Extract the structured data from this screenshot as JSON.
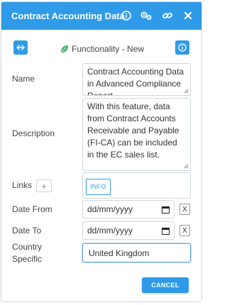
{
  "dialog": {
    "title": "Contract Accounting Data",
    "icons": [
      "info-icon",
      "settings-icon",
      "link-icon",
      "close-icon"
    ],
    "accent_color": "#2f9be8"
  },
  "toolbar": {
    "expand_icon": "expand-arrows-icon",
    "leaf_icon": "leaf-icon",
    "center_label": "Functionality - New",
    "info_icon": "info-icon"
  },
  "form": {
    "name_label": "Name",
    "name_value": "Contract Accounting Data in Advanced Compliance Report",
    "description_label": "Description",
    "description_value": "With this feature, data from Contract Accounts Receivable and Payable (FI-CA) can be included in the EC sales list.",
    "links_label": "Links",
    "links_add": "+",
    "links_tag": "INFO",
    "date_from_label": "Date From",
    "date_from_placeholder": "dd/mm/yyyy",
    "date_to_label": "Date To",
    "date_to_placeholder": "dd/mm/yyyy",
    "clear_label": "X",
    "country_label": "Country Specific",
    "country_value": "United Kingdom"
  },
  "footer": {
    "cancel_label": "CANCEL"
  }
}
